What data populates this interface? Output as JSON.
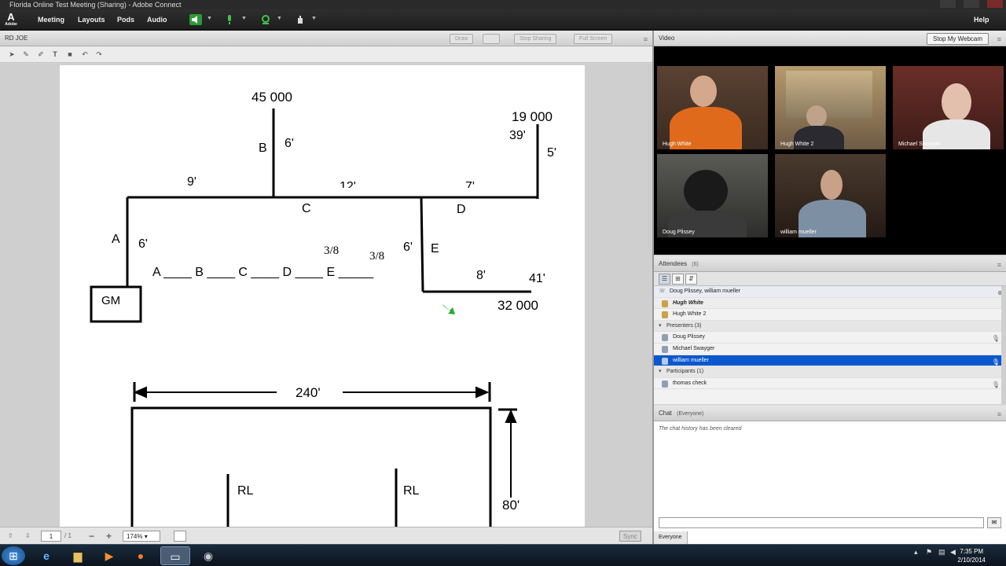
{
  "window": {
    "title": "Florida Online Test Meeting (Sharing) - Adobe Connect"
  },
  "menubar": {
    "logo_text": "A",
    "logo_sub": "Adobe",
    "items": [
      "Meeting",
      "Layouts",
      "Pods",
      "Audio"
    ],
    "help": "Help"
  },
  "share_pod": {
    "title": "RD JOE",
    "draw_btn": "Draw",
    "stop_sharing_btn": "Stop Sharing",
    "full_screen_btn": "Full Screen",
    "page_current": "1",
    "page_total": "/ 1",
    "zoom": "174%",
    "sync_btn": "Sync"
  },
  "document": {
    "top_diagram": {
      "values": {
        "v45000": "45 000",
        "v19000": "19 000",
        "v32000": "32 000",
        "gm": "GM"
      },
      "labels": {
        "b": "B",
        "c": "C",
        "d": "D",
        "a": "A",
        "e": "E"
      },
      "lengths": {
        "six_b": "6'",
        "thirtynine": "39'",
        "five": "5'",
        "nine": "9'",
        "twelve": "12'",
        "seven": "7'",
        "six_a": "6'",
        "six_e": "6'",
        "eight": "8'",
        "fortyone": "41'"
      },
      "fractions": {
        "f1": "3/8",
        "f2": "3/8"
      },
      "fill_line": "A ____ B ____ C ____ D ____ E _____"
    },
    "bottom_diagram": {
      "width": "240'",
      "height": "80'",
      "rl1": "RL",
      "rl2": "RL"
    }
  },
  "video_pod": {
    "title": "Video",
    "stop_webcam_btn": "Stop My Webcam",
    "tiles": [
      {
        "name": "Hugh White"
      },
      {
        "name": "Hugh White 2"
      },
      {
        "name": "Michael Swayger"
      },
      {
        "name": "Doug Plissey"
      },
      {
        "name": "william mueller"
      }
    ]
  },
  "attendees_pod": {
    "title": "Attendees",
    "count": "(6)",
    "speaking_bar": "Doug Plissey, william mueller",
    "hosts": [
      "Hugh White",
      "Hugh White 2"
    ],
    "presenters_header": "Presenters (3)",
    "presenters": [
      "Doug Plissey",
      "Michael Swayger",
      "william mueller"
    ],
    "participants_header": "Participants (1)",
    "participants": [
      "thomas check"
    ]
  },
  "chat_pod": {
    "title": "Chat",
    "scope": "(Everyone)",
    "message": "The chat history has been cleared",
    "target": "Everyone"
  },
  "taskbar": {
    "time": "7:35 PM",
    "date": "2/10/2014"
  },
  "colors": {
    "selected_row": "#0a58cc",
    "annotation_arrow": "#22aa33"
  }
}
